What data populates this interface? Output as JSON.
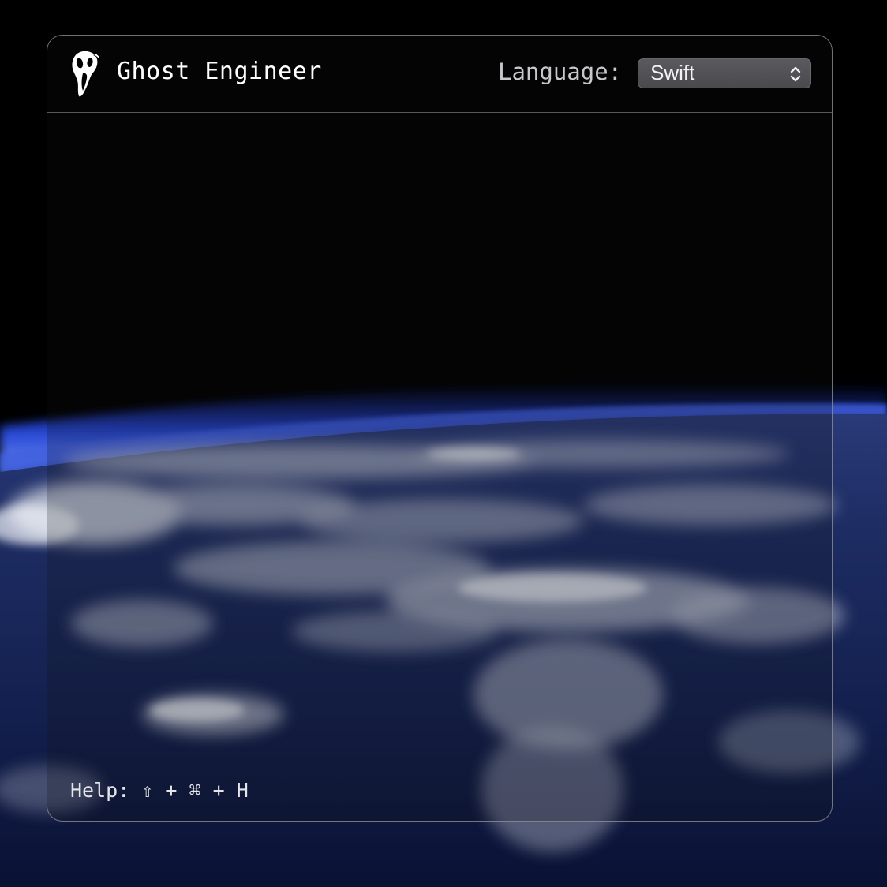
{
  "app": {
    "title": "Ghost Engineer",
    "logo_icon": "ghostface-mask-icon"
  },
  "header": {
    "language_label": "Language:",
    "language_select": {
      "selected": "Swift",
      "icon": "chevron-up-down-icon"
    }
  },
  "footer": {
    "help_text": "Help: ⇧ + ⌘ + H"
  },
  "colors": {
    "window_border": "#96969b",
    "select_bg": "#525256",
    "title_text": "#ffffff",
    "label_text": "#c8c8cc",
    "atmosphere": "#2b4bd0"
  }
}
